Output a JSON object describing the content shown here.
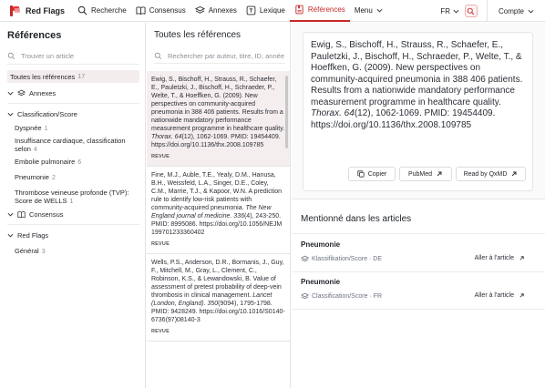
{
  "brand": {
    "name": "Red Flags"
  },
  "nav": {
    "items": [
      {
        "label": "Recherche",
        "icon": "search-icon"
      },
      {
        "label": "Consensus",
        "icon": "book-icon"
      },
      {
        "label": "Annexes",
        "icon": "layers-icon"
      },
      {
        "label": "Lexique",
        "icon": "quote-box-icon"
      },
      {
        "label": "Références",
        "icon": "bookmark-doc-icon",
        "active": true
      },
      {
        "label": "Menu",
        "icon": "chevron-down-icon"
      }
    ],
    "language": "FR",
    "account": "Compte"
  },
  "sidebar": {
    "title": "Références",
    "search_placeholder": "Trouver un article",
    "all": {
      "label": "Toutes les références",
      "count": "17"
    },
    "groups": {
      "annexes": "Annexes",
      "classification": "Classification/Score",
      "consensus": "Consensus",
      "redflags": "Red Flags"
    },
    "sub": [
      {
        "label": "Dyspnée",
        "count": "1"
      },
      {
        "label": "Insuffisance cardiaque, classification selon",
        "count": "4"
      },
      {
        "label": "Embolie pulmonaire",
        "count": "6"
      },
      {
        "label": "Pneumonie",
        "count": "2"
      },
      {
        "label": "Thrombose veineuse profonde (TVP): Score de WELLS",
        "count": "1"
      }
    ],
    "redflag_sub": {
      "label": "Général",
      "count": "3"
    }
  },
  "middle": {
    "title": "Toutes les références",
    "search_placeholder": "Rechercher par auteur, titre, ID, année",
    "refs": [
      {
        "pre": "Ewig, S., Bischoff, H., Strauss, R., Schaefer, E., Pauletzki, J., Bischoff, H., Schraeder, P., Welte, T., & Hoeffken, G. (2009). New perspectives on community-acquired pneumonia in 388 406 patients. Results from a nationwide mandatory performance measurement programme in healthcare quality. ",
        "journal": "Thorax. 64",
        "post": "(12), 1062-1069. PMID: 19454409. https://doi.org/10.1136/thx.2008.109785",
        "tag": "REVUE"
      },
      {
        "pre": "Fine, M.J., Auble, T.E., Yealy, D.M., Hanusa, B.H., Weissfeld, L.A., Singer, D.E., Coley, C.M., Marrie, T.J., & Kapoor, W.N. A prediction rule to identify low-risk patients with community-acquired pneumonia. ",
        "journal": "The New England journal of medicine. 336",
        "post": "(4), 243-250. PMID: 8995086. https://doi.org/10.1056/NEJM199701233360402",
        "tag": "REVUE"
      },
      {
        "pre": "Wells, P.S., Anderson, D.R., Bormanis, J., Guy, F., Mitchell, M., Gray, L., Clement, C., Robinson, K.S., & Lewandowski, B. Value of assessment of pretest probability of deep-vein thrombosis in clinical management. ",
        "journal": "Lancet (London, England). 350",
        "post": "(9094), 1795-1798. PMID: 9428249. https://doi.org/10.1016/S0140-6736(97)08140-3",
        "tag": "REVUE"
      }
    ]
  },
  "detail": {
    "citation_pre": "Ewig, S., Bischoff, H., Strauss, R., Schaefer, E., Pauletzki, J., Bischoff, H., Schraeder, P., Welte, T., & Hoeffken, G. (2009). New perspectives on community-acquired pneumonia in 388 406 patients. Results from a nationwide mandatory performance measurement programme in healthcare quality. ",
    "citation_journal": "Thorax. 64",
    "citation_post": "(12), 1062-1069. PMID: 19454409. https://doi.org/10.1136/thx.2008.109785",
    "buttons": {
      "copy": "Copier",
      "pubmed": "PubMed",
      "qxmd": "Read by QxMD"
    },
    "mentions_title": "Mentionné dans les articles",
    "mentions": [
      {
        "title": "Pneumonie",
        "meta": "Klassifikation/Score · DE",
        "goto": "Aller à l'article"
      },
      {
        "title": "Pneumonie",
        "meta": "Classification/Score · FR",
        "goto": "Aller à l'article"
      }
    ]
  },
  "colors": {
    "accent": "#c62828",
    "active_bg": "#f4eeee"
  }
}
